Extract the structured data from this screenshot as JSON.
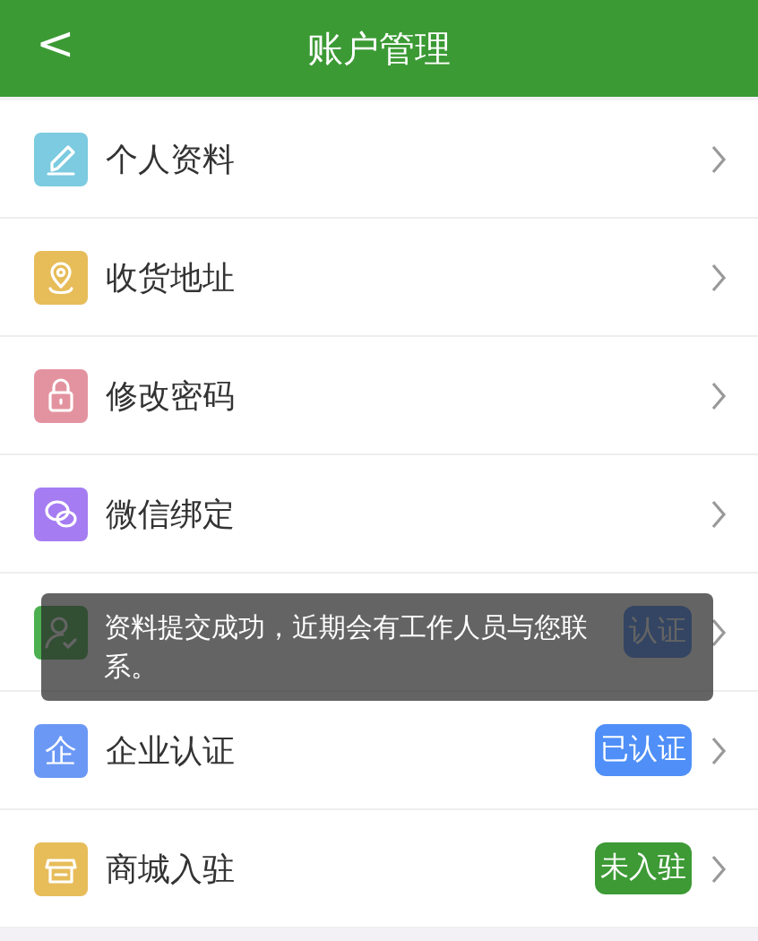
{
  "header": {
    "back": "<",
    "title": "账户管理"
  },
  "rows": [
    {
      "label": "个人资料",
      "color": "#7ccbe0"
    },
    {
      "label": "收货地址",
      "color": "#e7bd5a"
    },
    {
      "label": "修改密码",
      "color": "#e3939f"
    },
    {
      "label": "微信绑定",
      "color": "#a57cf2"
    },
    {
      "color": "#4caf50",
      "badge": {
        "text": "认证"
      }
    },
    {
      "label": "企业认证",
      "color": "#6b98f5",
      "icon_text": "企",
      "badge": {
        "text": "已认证",
        "color": "#4f8ff7"
      }
    },
    {
      "label": "商城入驻",
      "color": "#e7bd5a",
      "badge": {
        "text": "未入驻",
        "color": "#3d9a35"
      }
    }
  ],
  "toast": {
    "text": "资料提交成功，近期会有工作人员与您联系。"
  }
}
